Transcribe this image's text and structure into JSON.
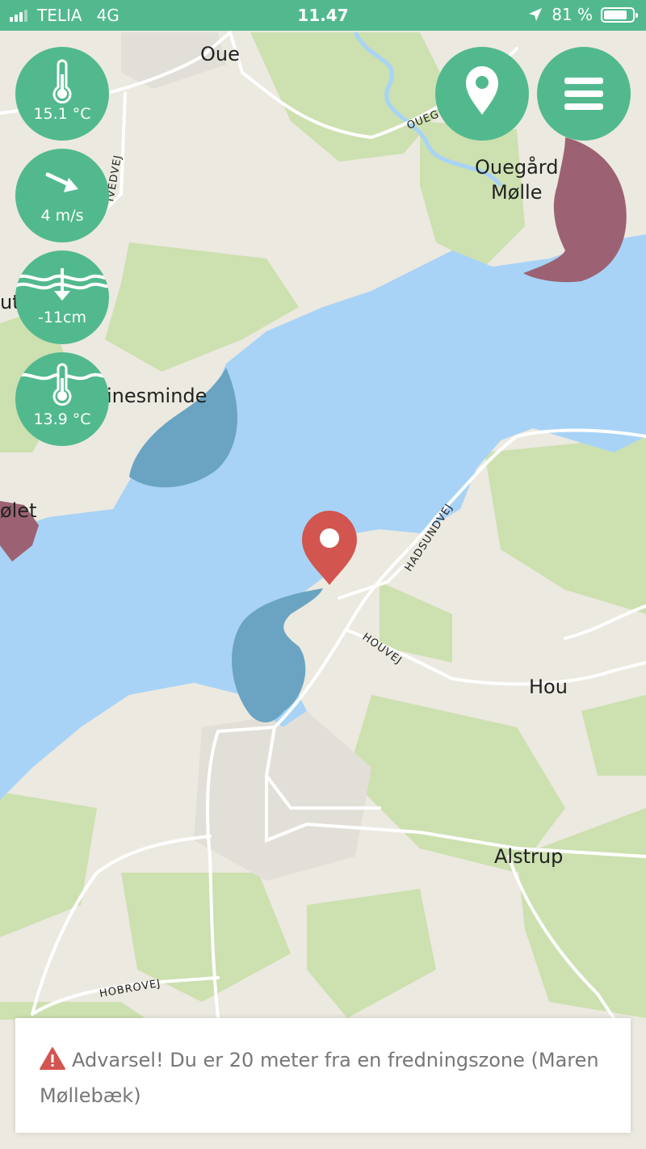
{
  "status_bar": {
    "carrier": "TELIA",
    "network": "4G",
    "time": "11.47",
    "battery_percent": "81 %",
    "battery_level": 0.81
  },
  "map": {
    "place_labels": [
      "Oue",
      "Ouegård",
      "Mølle",
      "ut",
      "inesminde",
      "ølet",
      "Hou",
      "Alstrup"
    ],
    "road_labels": [
      "HADSUNDVEJ",
      "HOUVEJ",
      "HOBROVEJ",
      "OUEG",
      "IVEDVEJ"
    ],
    "colors": {
      "water": "#a8d3f7",
      "land": "#ece9e0",
      "forest": "#cde0b0",
      "blue_zone": "#6aa4c2",
      "red_zone": "#9c6273",
      "marker": "#d35550"
    }
  },
  "weather": {
    "air_temp": "15.1 °C",
    "wind": "4 m/s",
    "water_level": "-11cm",
    "water_temp": "13.9 °C"
  },
  "controls": {
    "location_icon": "map-pin-icon",
    "menu_icon": "hamburger-menu-icon"
  },
  "warning": {
    "text": "Advarsel! Du er 20 meter fra en fredningszone (Maren Møllebæk)",
    "color": "#d35550"
  }
}
